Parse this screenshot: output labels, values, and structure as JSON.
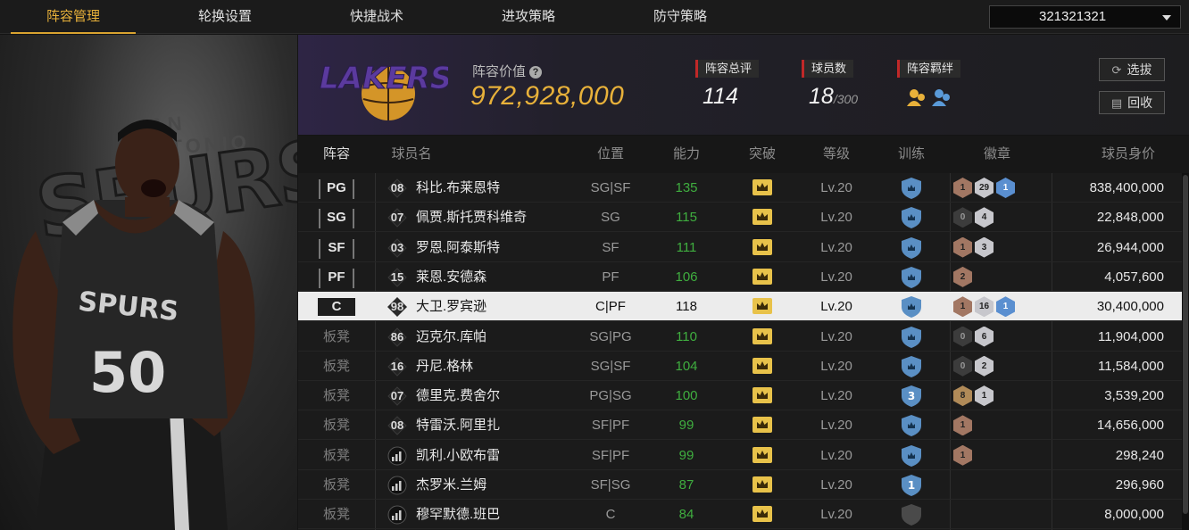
{
  "nav": {
    "tabs": [
      {
        "label": "阵容管理",
        "active": true
      },
      {
        "label": "轮换设置",
        "active": false
      },
      {
        "label": "快捷战术",
        "active": false
      },
      {
        "label": "进攻策略",
        "active": false
      },
      {
        "label": "防守策略",
        "active": false
      }
    ],
    "account": "321321321"
  },
  "player_image": {
    "team_wordmark": "SPURS",
    "city": "SAN ANTONIO",
    "jersey": "SPURS 50"
  },
  "summary": {
    "team_logo_text": "LAKERS",
    "value_label": "阵容价值",
    "value": "972,928,000",
    "rating_label": "阵容总评",
    "rating": "114",
    "players_label": "球员数",
    "players": "18",
    "players_max": "/300",
    "bond_label": "阵容羁绊",
    "draft_button": "选拔",
    "recycle_button": "回收"
  },
  "table": {
    "headers": [
      "阵容",
      "球员名",
      "位置",
      "能力",
      "突破",
      "等级",
      "训练",
      "徽章",
      "球员身价"
    ],
    "rows": [
      {
        "slot": "PG",
        "bench": false,
        "number": "08",
        "icon": "jersey",
        "name": "科比.布莱恩特",
        "pos": "SG|SF",
        "ability": "135",
        "level": "Lv.20",
        "train": "shield",
        "badges": [
          {
            "t": "bronze",
            "n": "1"
          },
          {
            "t": "silver",
            "n": "29"
          },
          {
            "t": "blue",
            "n": "1"
          }
        ],
        "price": "838,400,000",
        "selected": false
      },
      {
        "slot": "SG",
        "bench": false,
        "number": "07",
        "icon": "jersey",
        "name": "佩贾.斯托贾科维奇",
        "pos": "SG",
        "ability": "115",
        "level": "Lv.20",
        "train": "shield",
        "badges": [
          {
            "t": "dark",
            "n": "0"
          },
          {
            "t": "silver",
            "n": "4"
          }
        ],
        "price": "22,848,000",
        "selected": false
      },
      {
        "slot": "SF",
        "bench": false,
        "number": "03",
        "icon": "jersey",
        "name": "罗恩.阿泰斯特",
        "pos": "SF",
        "ability": "111",
        "level": "Lv.20",
        "train": "shield",
        "badges": [
          {
            "t": "bronze",
            "n": "1"
          },
          {
            "t": "silver",
            "n": "3"
          }
        ],
        "price": "26,944,000",
        "selected": false
      },
      {
        "slot": "PF",
        "bench": false,
        "number": "15",
        "icon": "jersey",
        "name": "莱恩.安德森",
        "pos": "PF",
        "ability": "106",
        "level": "Lv.20",
        "train": "shield",
        "badges": [
          {
            "t": "bronze",
            "n": "2"
          }
        ],
        "price": "4,057,600",
        "selected": false
      },
      {
        "slot": "C",
        "bench": false,
        "number": "98",
        "icon": "diamond",
        "name": "大卫.罗宾逊",
        "pos": "C|PF",
        "ability": "118",
        "level": "Lv.20",
        "train": "shield",
        "badges": [
          {
            "t": "bronze",
            "n": "1"
          },
          {
            "t": "silver",
            "n": "16"
          },
          {
            "t": "blue",
            "n": "1"
          }
        ],
        "price": "30,400,000",
        "selected": true
      },
      {
        "slot": "板凳",
        "bench": true,
        "number": "86",
        "icon": "jersey",
        "name": "迈克尔.库帕",
        "pos": "SG|PG",
        "ability": "110",
        "level": "Lv.20",
        "train": "shield",
        "badges": [
          {
            "t": "dark",
            "n": "0"
          },
          {
            "t": "silver",
            "n": "6"
          }
        ],
        "price": "11,904,000",
        "selected": false
      },
      {
        "slot": "板凳",
        "bench": true,
        "number": "16",
        "icon": "jersey",
        "name": "丹尼.格林",
        "pos": "SG|SF",
        "ability": "104",
        "level": "Lv.20",
        "train": "shield",
        "badges": [
          {
            "t": "dark",
            "n": "0"
          },
          {
            "t": "silver",
            "n": "2"
          }
        ],
        "price": "11,584,000",
        "selected": false
      },
      {
        "slot": "板凳",
        "bench": true,
        "number": "07",
        "icon": "jersey",
        "name": "德里克.费舍尔",
        "pos": "PG|SG",
        "ability": "100",
        "level": "Lv.20",
        "train": "shield3",
        "badges": [
          {
            "t": "gold",
            "n": "8"
          },
          {
            "t": "silver",
            "n": "1"
          }
        ],
        "price": "3,539,200",
        "selected": false
      },
      {
        "slot": "板凳",
        "bench": true,
        "number": "08",
        "icon": "jersey",
        "name": "特雷沃.阿里扎",
        "pos": "SF|PF",
        "ability": "99",
        "level": "Lv.20",
        "train": "shield",
        "badges": [
          {
            "t": "bronze",
            "n": "1"
          }
        ],
        "price": "14,656,000",
        "selected": false
      },
      {
        "slot": "板凳",
        "bench": true,
        "number": "",
        "icon": "bars",
        "name": "凯利.小欧布雷",
        "pos": "SF|PF",
        "ability": "99",
        "level": "Lv.20",
        "train": "shield",
        "badges": [
          {
            "t": "bronze",
            "n": "1"
          }
        ],
        "price": "298,240",
        "selected": false
      },
      {
        "slot": "板凳",
        "bench": true,
        "number": "",
        "icon": "bars",
        "name": "杰罗米.兰姆",
        "pos": "SF|SG",
        "ability": "87",
        "level": "Lv.20",
        "train": "shield1",
        "badges": [],
        "price": "296,960",
        "selected": false
      },
      {
        "slot": "板凳",
        "bench": true,
        "number": "",
        "icon": "bars",
        "name": "穆罕默德.班巴",
        "pos": "C",
        "ability": "84",
        "level": "Lv.20",
        "train": "shieldgray",
        "badges": [],
        "price": "8,000,000",
        "selected": false
      }
    ]
  },
  "colors": {
    "accent": "#e8b13a",
    "ability_green": "#3fae3f",
    "stat_red": "#c02828",
    "train_blue": "#5a8fc4"
  }
}
